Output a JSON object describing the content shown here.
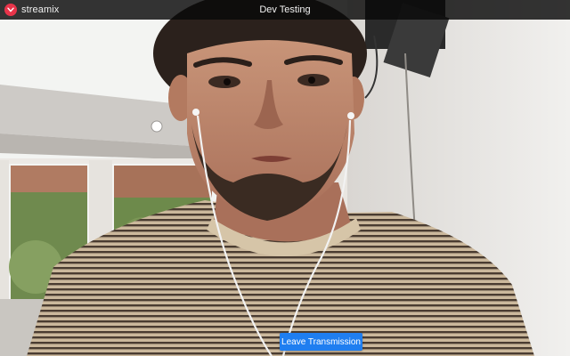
{
  "app": {
    "brand_name": "streamix",
    "logo_icon": "streamix-logo-icon",
    "brand_color": "#e8344a"
  },
  "header": {
    "room_title": "Dev Testing"
  },
  "controls": {
    "leave_label": "Leave Transmission",
    "leave_color": "#1f7ef0"
  },
  "video": {
    "content": "live-webcam-feed"
  }
}
